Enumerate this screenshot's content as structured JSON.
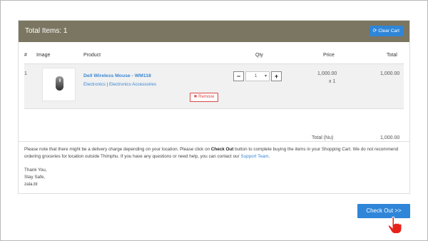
{
  "header": {
    "title": "Total Items: 1",
    "clear_cart_label": "Clear Cart",
    "clear_cart_icon": "refresh-icon"
  },
  "table": {
    "columns": [
      "#",
      "Image",
      "Product",
      "Qty",
      "Price",
      "Total"
    ],
    "rows": [
      {
        "index": "1",
        "image_icon": "mouse-icon",
        "product_name": "Dell Wireless Mouse - WM118",
        "category_1": "Electronics",
        "category_sep": "|",
        "category_2": "Electronics Accessories",
        "remove_label": "Remove",
        "remove_icon": "close-icon",
        "qty_minus": "−",
        "qty_value": "1",
        "qty_plus": "+",
        "price": "1,000.00",
        "price_qty": "x 1",
        "total": "1,000.00"
      }
    ],
    "total_label": "Total (Nu)",
    "total_value": "1,000.00"
  },
  "note": {
    "text_1": "Please note that there might be a delivery charge depending on your location. Please click on ",
    "bold": "Check Out",
    "text_2": " button to complete buying the items in your Shopping Cart. We do not recommend ordering groceries for location outside Thimphu. If you have any questions or need help, you can contact our ",
    "link": "Support Team",
    "text_3": "."
  },
  "signoff": [
    "Thank You,",
    "Stay Safe,",
    "zala.bt"
  ],
  "checkout_label": "Check Out >>",
  "colors": {
    "header_bg": "#7b7661",
    "accent_blue": "#2f86d8",
    "remove_red": "#d94848",
    "cursor_red": "#e8211b"
  }
}
